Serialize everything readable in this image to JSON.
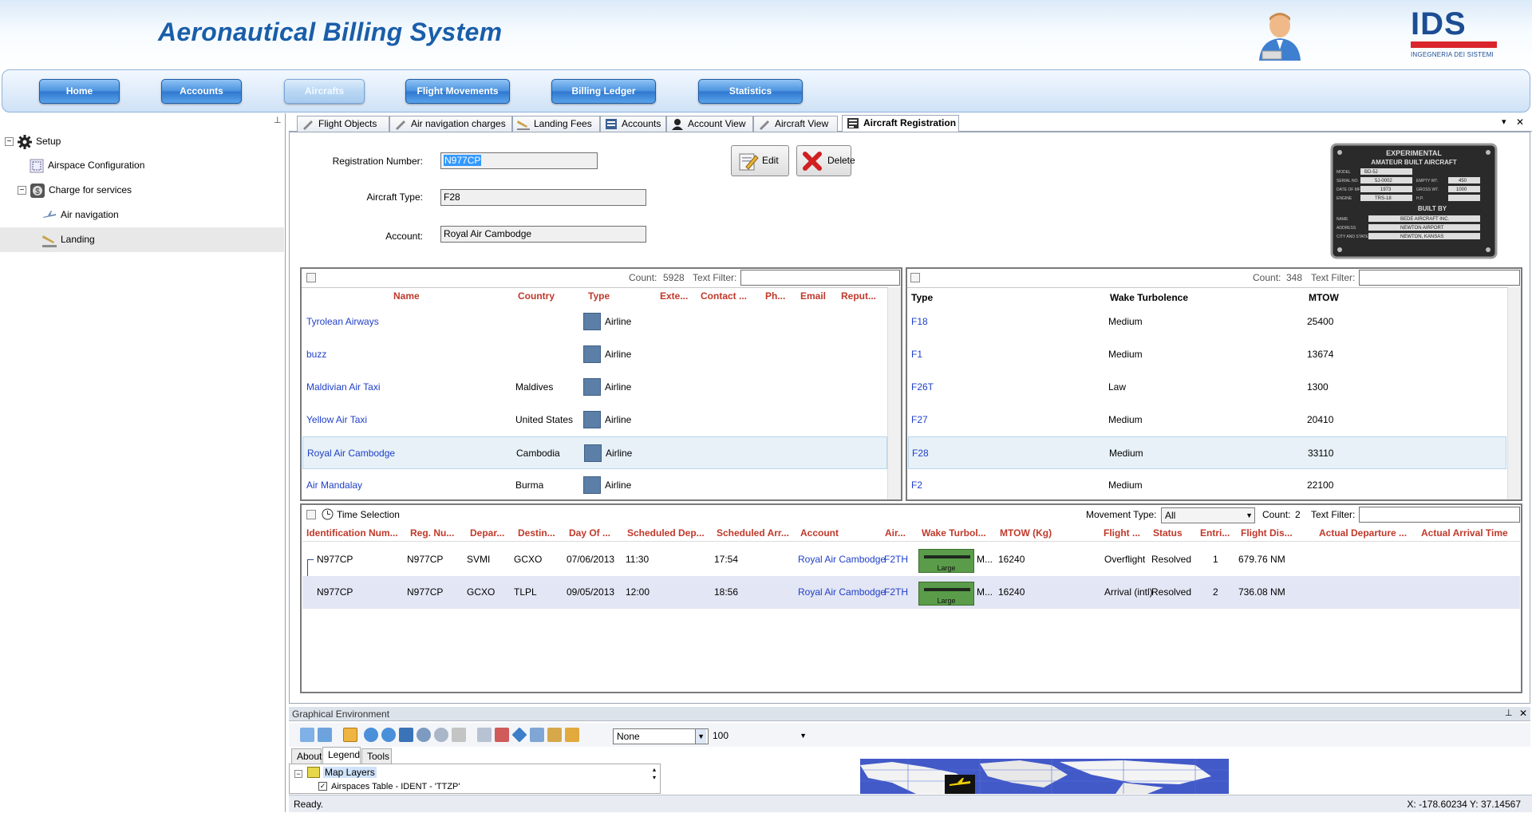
{
  "app": {
    "title": "Aeronautical Billing System",
    "logo_text": "IDS",
    "logo_subtitle": "INGEGNERIA DEI SISTEMI"
  },
  "nav": [
    {
      "label": "Home"
    },
    {
      "label": "Accounts"
    },
    {
      "label": "Aircrafts",
      "active": true
    },
    {
      "label": "Flight Movements"
    },
    {
      "label": "Billing Ledger"
    },
    {
      "label": "Statistics"
    }
  ],
  "tree": {
    "pin": "⊥",
    "items": [
      {
        "label": "Setup"
      },
      {
        "label": "Airspace Configuration"
      },
      {
        "label": "Charge for services"
      },
      {
        "label": "Air navigation"
      },
      {
        "label": "Landing"
      }
    ]
  },
  "tabs": [
    {
      "label": "Flight Objects"
    },
    {
      "label": "Air navigation charges"
    },
    {
      "label": "Landing Fees"
    },
    {
      "label": "Accounts"
    },
    {
      "label": "Account View"
    },
    {
      "label": "Aircraft View"
    },
    {
      "label": "Aircraft Registration",
      "active": true
    }
  ],
  "tab_controls": {
    "dropdown": "▾",
    "close": "✕"
  },
  "form": {
    "registration_label": "Registration Number:",
    "registration_value": "N977CP",
    "aircraft_type_label": "Aircraft Type:",
    "aircraft_type_value": "F28",
    "account_label": "Account:",
    "account_value": "Royal Air Cambodge",
    "edit_label": "Edit",
    "delete_label": "Delete"
  },
  "plate": {
    "title1": "EXPERIMENTAL",
    "title2": "AMATEUR BUILT AIRCRAFT",
    "model_label": "MODEL",
    "model": "BD-5J",
    "serial_label": "SERIAL NO.",
    "serial": "5J-0002",
    "date_label": "DATE OF MFG.",
    "date": "1973",
    "engine_label": "ENGINE",
    "engine": "TRS-18",
    "empty_label": "EMPTY WT.",
    "empty": "450",
    "gross_label": "GROSS WT.",
    "gross": "1000",
    "hp_label": "H.P.",
    "hp": "",
    "built_by": "BUILT BY",
    "name_label": "NAME",
    "name": "BEDE AIRCRAFT INC.",
    "address_label": "ADDRESS",
    "address": "NEWTON AIRPORT",
    "city_label": "CITY AND STATE",
    "city": "NEWTON, KANSAS"
  },
  "accounts_grid": {
    "count_label": "Count:",
    "count": "5928",
    "filter_label": "Text Filter:",
    "columns": [
      "Name",
      "Country",
      "Type",
      "Exte...",
      "Contact ...",
      "Ph...",
      "Email",
      "Reput..."
    ],
    "rows": [
      {
        "name": "Tyrolean Airways",
        "country": "",
        "type": "Airline"
      },
      {
        "name": "buzz",
        "country": "",
        "type": "Airline"
      },
      {
        "name": "Maldivian Air Taxi",
        "country": "Maldives",
        "type": "Airline"
      },
      {
        "name": "Yellow Air Taxi",
        "country": "United States",
        "type": "Airline"
      },
      {
        "name": "Royal Air Cambodge",
        "country": "Cambodia",
        "type": "Airline",
        "selected": true
      },
      {
        "name": "Air Mandalay",
        "country": "Burma",
        "type": "Airline"
      }
    ]
  },
  "types_grid": {
    "count_label": "Count:",
    "count": "348",
    "filter_label": "Text Filter:",
    "columns": [
      "Type",
      "Wake Turbolence",
      "MTOW"
    ],
    "rows": [
      {
        "type": "F18",
        "wake": "Medium",
        "mtow": "25400"
      },
      {
        "type": "F1",
        "wake": "Medium",
        "mtow": "13674"
      },
      {
        "type": "F26T",
        "wake": "Law",
        "mtow": "1300"
      },
      {
        "type": "F27",
        "wake": "Medium",
        "mtow": "20410"
      },
      {
        "type": "F28",
        "wake": "Medium",
        "mtow": "33110",
        "selected": true
      },
      {
        "type": "F2",
        "wake": "Medium",
        "mtow": "22100"
      }
    ]
  },
  "movements_grid": {
    "time_selection_label": "Time Selection",
    "movement_type_label": "Movement Type:",
    "movement_type_value": "All",
    "count_label": "Count:",
    "count": "2",
    "filter_label": "Text Filter:",
    "columns": [
      "Identification Num...",
      "Reg. Nu...",
      "Depar...",
      "Destin...",
      "Day Of ...",
      "Scheduled Dep...",
      "Scheduled Arr...",
      "Account",
      "Air...",
      "Wake Turbol...",
      "MTOW (Kg)",
      "Flight ...",
      "Status",
      "Entri...",
      "Flight Dis...",
      "Actual Departure ...",
      "Actual Arrival Time"
    ],
    "rows": [
      {
        "id": "N977CP",
        "reg": "N977CP",
        "dep": "SVMI",
        "dest": "GCXO",
        "day": "07/06/2013",
        "sdep": "11:30",
        "sarr": "17:54",
        "account": "Royal Air Cambodge",
        "aircraft": "F2TH",
        "wake_label": "Large",
        "wake_abbr": "M...",
        "mtow": "16240",
        "flight": "Overflight",
        "status": "Resolved",
        "entries": "1",
        "distance": "679.76 NM"
      },
      {
        "id": "N977CP",
        "reg": "N977CP",
        "dep": "GCXO",
        "dest": "TLPL",
        "day": "09/05/2013",
        "sdep": "12:00",
        "sarr": "18:56",
        "account": "Royal Air Cambodge",
        "aircraft": "F2TH",
        "wake_label": "Large",
        "wake_abbr": "M...",
        "mtow": "16240",
        "flight": "Arrival (intl)",
        "status": "Resolved",
        "entries": "2",
        "distance": "736.08 NM"
      }
    ]
  },
  "graphical_env": {
    "title": "Graphical Environment",
    "layer_select": "None",
    "zoom_value": "100",
    "subtabs": [
      "About",
      "Legend",
      "Tools"
    ],
    "legend_root": "Map Layers",
    "legend_item": "Airspaces Table - IDENT - 'TTZP'"
  },
  "status": {
    "text": "Ready.",
    "coords": "X: -178.60234  Y: 37.14567"
  },
  "colors": {
    "brand": "#1a5ea9",
    "header_text": "#c0392b",
    "link": "#2040c8"
  }
}
